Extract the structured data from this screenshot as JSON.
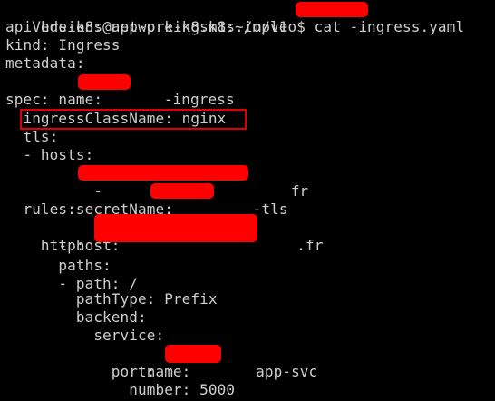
{
  "terminal": {
    "prompt": "hde-k8s@app-pre-k8sm1:~/mpleo$ cat ",
    "command_suffix": "-ingress.yaml",
    "lines": {
      "apiVersion": "apiVersion: networking.k8s.io/v1",
      "kind": "kind: Ingress",
      "metadata": "metadata:",
      "name_prefix": "  name: ",
      "name_suffix": "-ingress",
      "spec": "spec:",
      "ingressClassName": "  ingressClassName: nginx",
      "tls": "  tls:",
      "hosts_key": "  - hosts:",
      "hosts_item_prefix": "      - ",
      "hosts_item_suffix": "fr",
      "secretName_prefix": "    secretName: ",
      "secretName_suffix": "-tls",
      "rules": "  rules:",
      "host_prefix": "  - host: ",
      "host_suffix": ".fr",
      "http": "    http:",
      "paths": "      paths:",
      "path": "      - path: /",
      "pathType": "        pathType: Prefix",
      "backend": "        backend:",
      "service": "          service:",
      "service_name_prefix": "            name: ",
      "service_name_suffix": "app-svc",
      "port": "            port:",
      "number": "              number: 5000"
    }
  },
  "colors": {
    "background": "#000000",
    "text": "#cfcfcf",
    "redaction": "#ff0000",
    "highlight_border": "#e00000"
  }
}
